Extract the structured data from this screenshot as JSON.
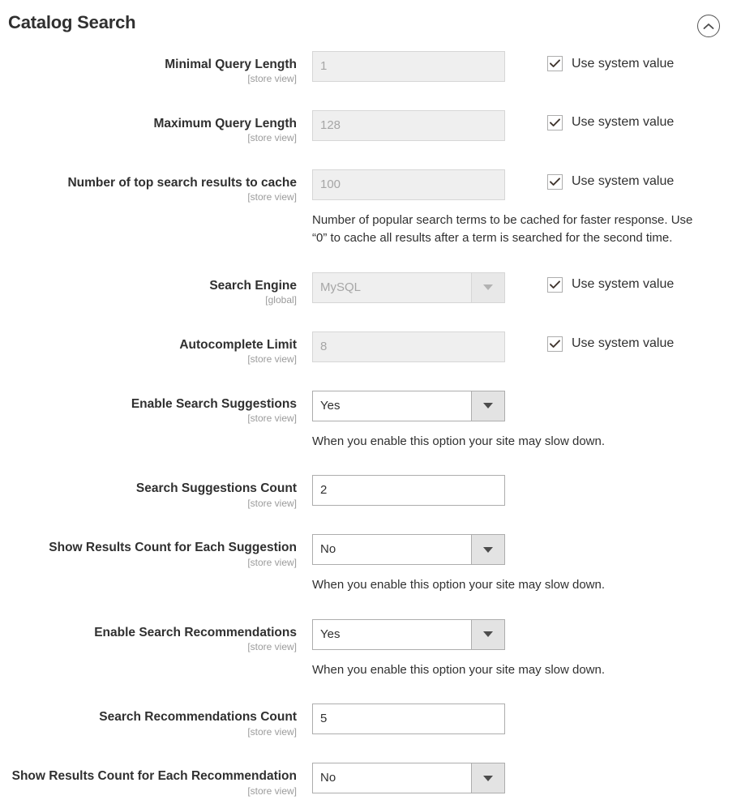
{
  "section": {
    "title": "Catalog Search",
    "collapse_icon": "chevron-up-icon"
  },
  "use_system_value_label": "Use system value",
  "scopes": {
    "store_view": "[store view]",
    "global": "[global]"
  },
  "fields": [
    {
      "label": "Minimal Query Length",
      "scope": "[store view]",
      "type": "input",
      "value": "1",
      "disabled": true,
      "use_system_value": true,
      "use_system_value_label": "Use system value",
      "note": ""
    },
    {
      "label": "Maximum Query Length",
      "scope": "[store view]",
      "type": "input",
      "value": "128",
      "disabled": true,
      "use_system_value": true,
      "use_system_value_label": "Use system value",
      "note": ""
    },
    {
      "label": "Number of top search results to cache",
      "scope": "[store view]",
      "type": "input",
      "value": "100",
      "disabled": true,
      "use_system_value": true,
      "use_system_value_label": "Use system value",
      "note": "Number of popular search terms to be cached for faster response. Use “0” to cache all results after a term is searched for the second time."
    },
    {
      "label": "Search Engine",
      "scope": "[global]",
      "type": "select",
      "value": "MySQL",
      "disabled": true,
      "use_system_value": true,
      "use_system_value_label": "Use system value",
      "note": ""
    },
    {
      "label": "Autocomplete Limit",
      "scope": "[store view]",
      "type": "input",
      "value": "8",
      "disabled": true,
      "use_system_value": true,
      "use_system_value_label": "Use system value",
      "note": ""
    },
    {
      "label": "Enable Search Suggestions",
      "scope": "[store view]",
      "type": "select",
      "value": "Yes",
      "disabled": false,
      "use_system_value": false,
      "use_system_value_label": "",
      "note": "When you enable this option your site may slow down."
    },
    {
      "label": "Search Suggestions Count",
      "scope": "[store view]",
      "type": "input",
      "value": "2",
      "disabled": false,
      "use_system_value": false,
      "use_system_value_label": "",
      "note": ""
    },
    {
      "label": "Show Results Count for Each Suggestion",
      "scope": "[store view]",
      "type": "select",
      "value": "No",
      "disabled": false,
      "use_system_value": false,
      "use_system_value_label": "",
      "note": "When you enable this option your site may slow down."
    },
    {
      "label": "Enable Search Recommendations",
      "scope": "[store view]",
      "type": "select",
      "value": "Yes",
      "disabled": false,
      "use_system_value": false,
      "use_system_value_label": "",
      "note": "When you enable this option your site may slow down."
    },
    {
      "label": "Search Recommendations Count",
      "scope": "[store view]",
      "type": "input",
      "value": "5",
      "disabled": false,
      "use_system_value": false,
      "use_system_value_label": "",
      "note": ""
    },
    {
      "label": "Show Results Count for Each Recommendation",
      "scope": "[store view]",
      "type": "select",
      "value": "No",
      "disabled": false,
      "use_system_value": false,
      "use_system_value_label": "",
      "note": ""
    }
  ],
  "colors": {
    "text": "#303030",
    "muted": "#9b9b9b",
    "border": "#adadad",
    "disabled_bg": "#efefef",
    "select_button_bg": "#e3e3e3"
  }
}
